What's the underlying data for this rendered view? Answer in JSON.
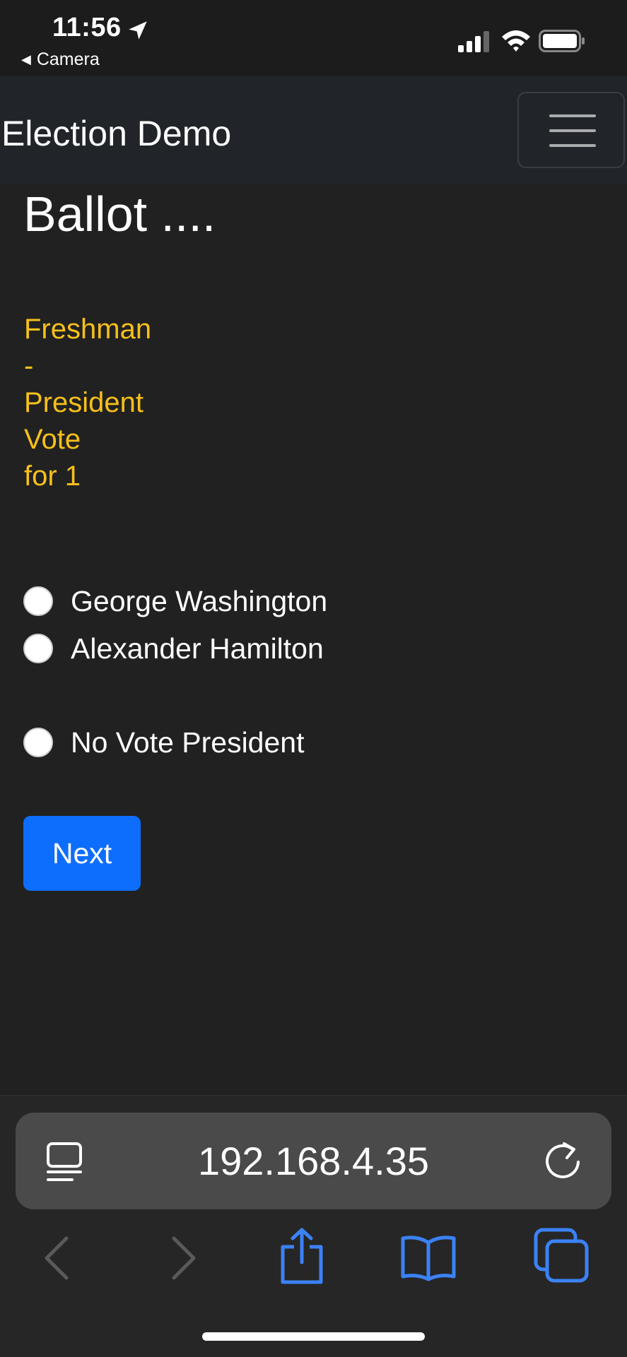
{
  "status_bar": {
    "time": "11:56",
    "back_label": "Camera",
    "icons": [
      "location-arrow-icon",
      "signal-icon",
      "wifi-icon",
      "battery-icon"
    ]
  },
  "navbar": {
    "brand": "Election Demo",
    "toggler_icon": "hamburger-menu-icon"
  },
  "page": {
    "title": "Ballot ....",
    "race_heading_lines": [
      "Freshman",
      "-",
      "President",
      "Vote",
      "for 1"
    ],
    "race_heading_color": "#f6c01b",
    "options": [
      {
        "label": "George Washington",
        "selected": false
      },
      {
        "label": "Alexander Hamilton",
        "selected": false
      },
      {
        "label": "No Vote President",
        "selected": false
      }
    ],
    "next_button": {
      "label": "Next",
      "color": "#0d6efd"
    }
  },
  "browser": {
    "url": "192.168.4.35",
    "accent_color": "#3b82f6",
    "icons": [
      "reader-icon",
      "reload-icon",
      "back-icon",
      "forward-icon",
      "share-icon",
      "bookmarks-icon",
      "tabs-icon"
    ]
  },
  "colors": {
    "background": "#212121",
    "navbar": "#212529"
  }
}
